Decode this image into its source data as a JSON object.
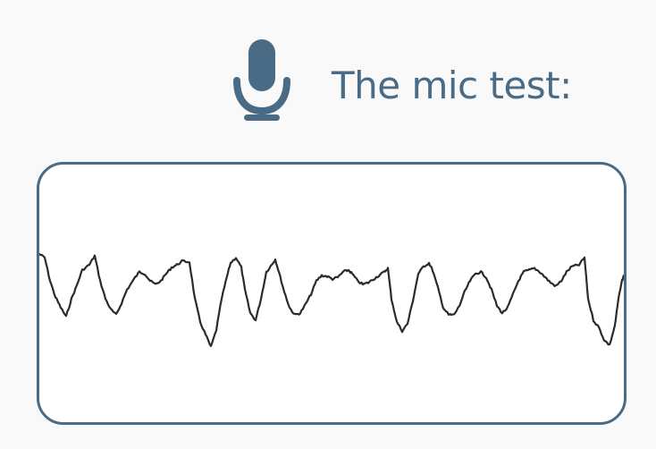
{
  "header": {
    "title": "The mic test:",
    "icon": "microphone-icon"
  },
  "colors": {
    "accent": "#4a6b85",
    "background": "#f9f9f9",
    "panel": "#ffffff",
    "waveform": "#2b2b2b"
  }
}
